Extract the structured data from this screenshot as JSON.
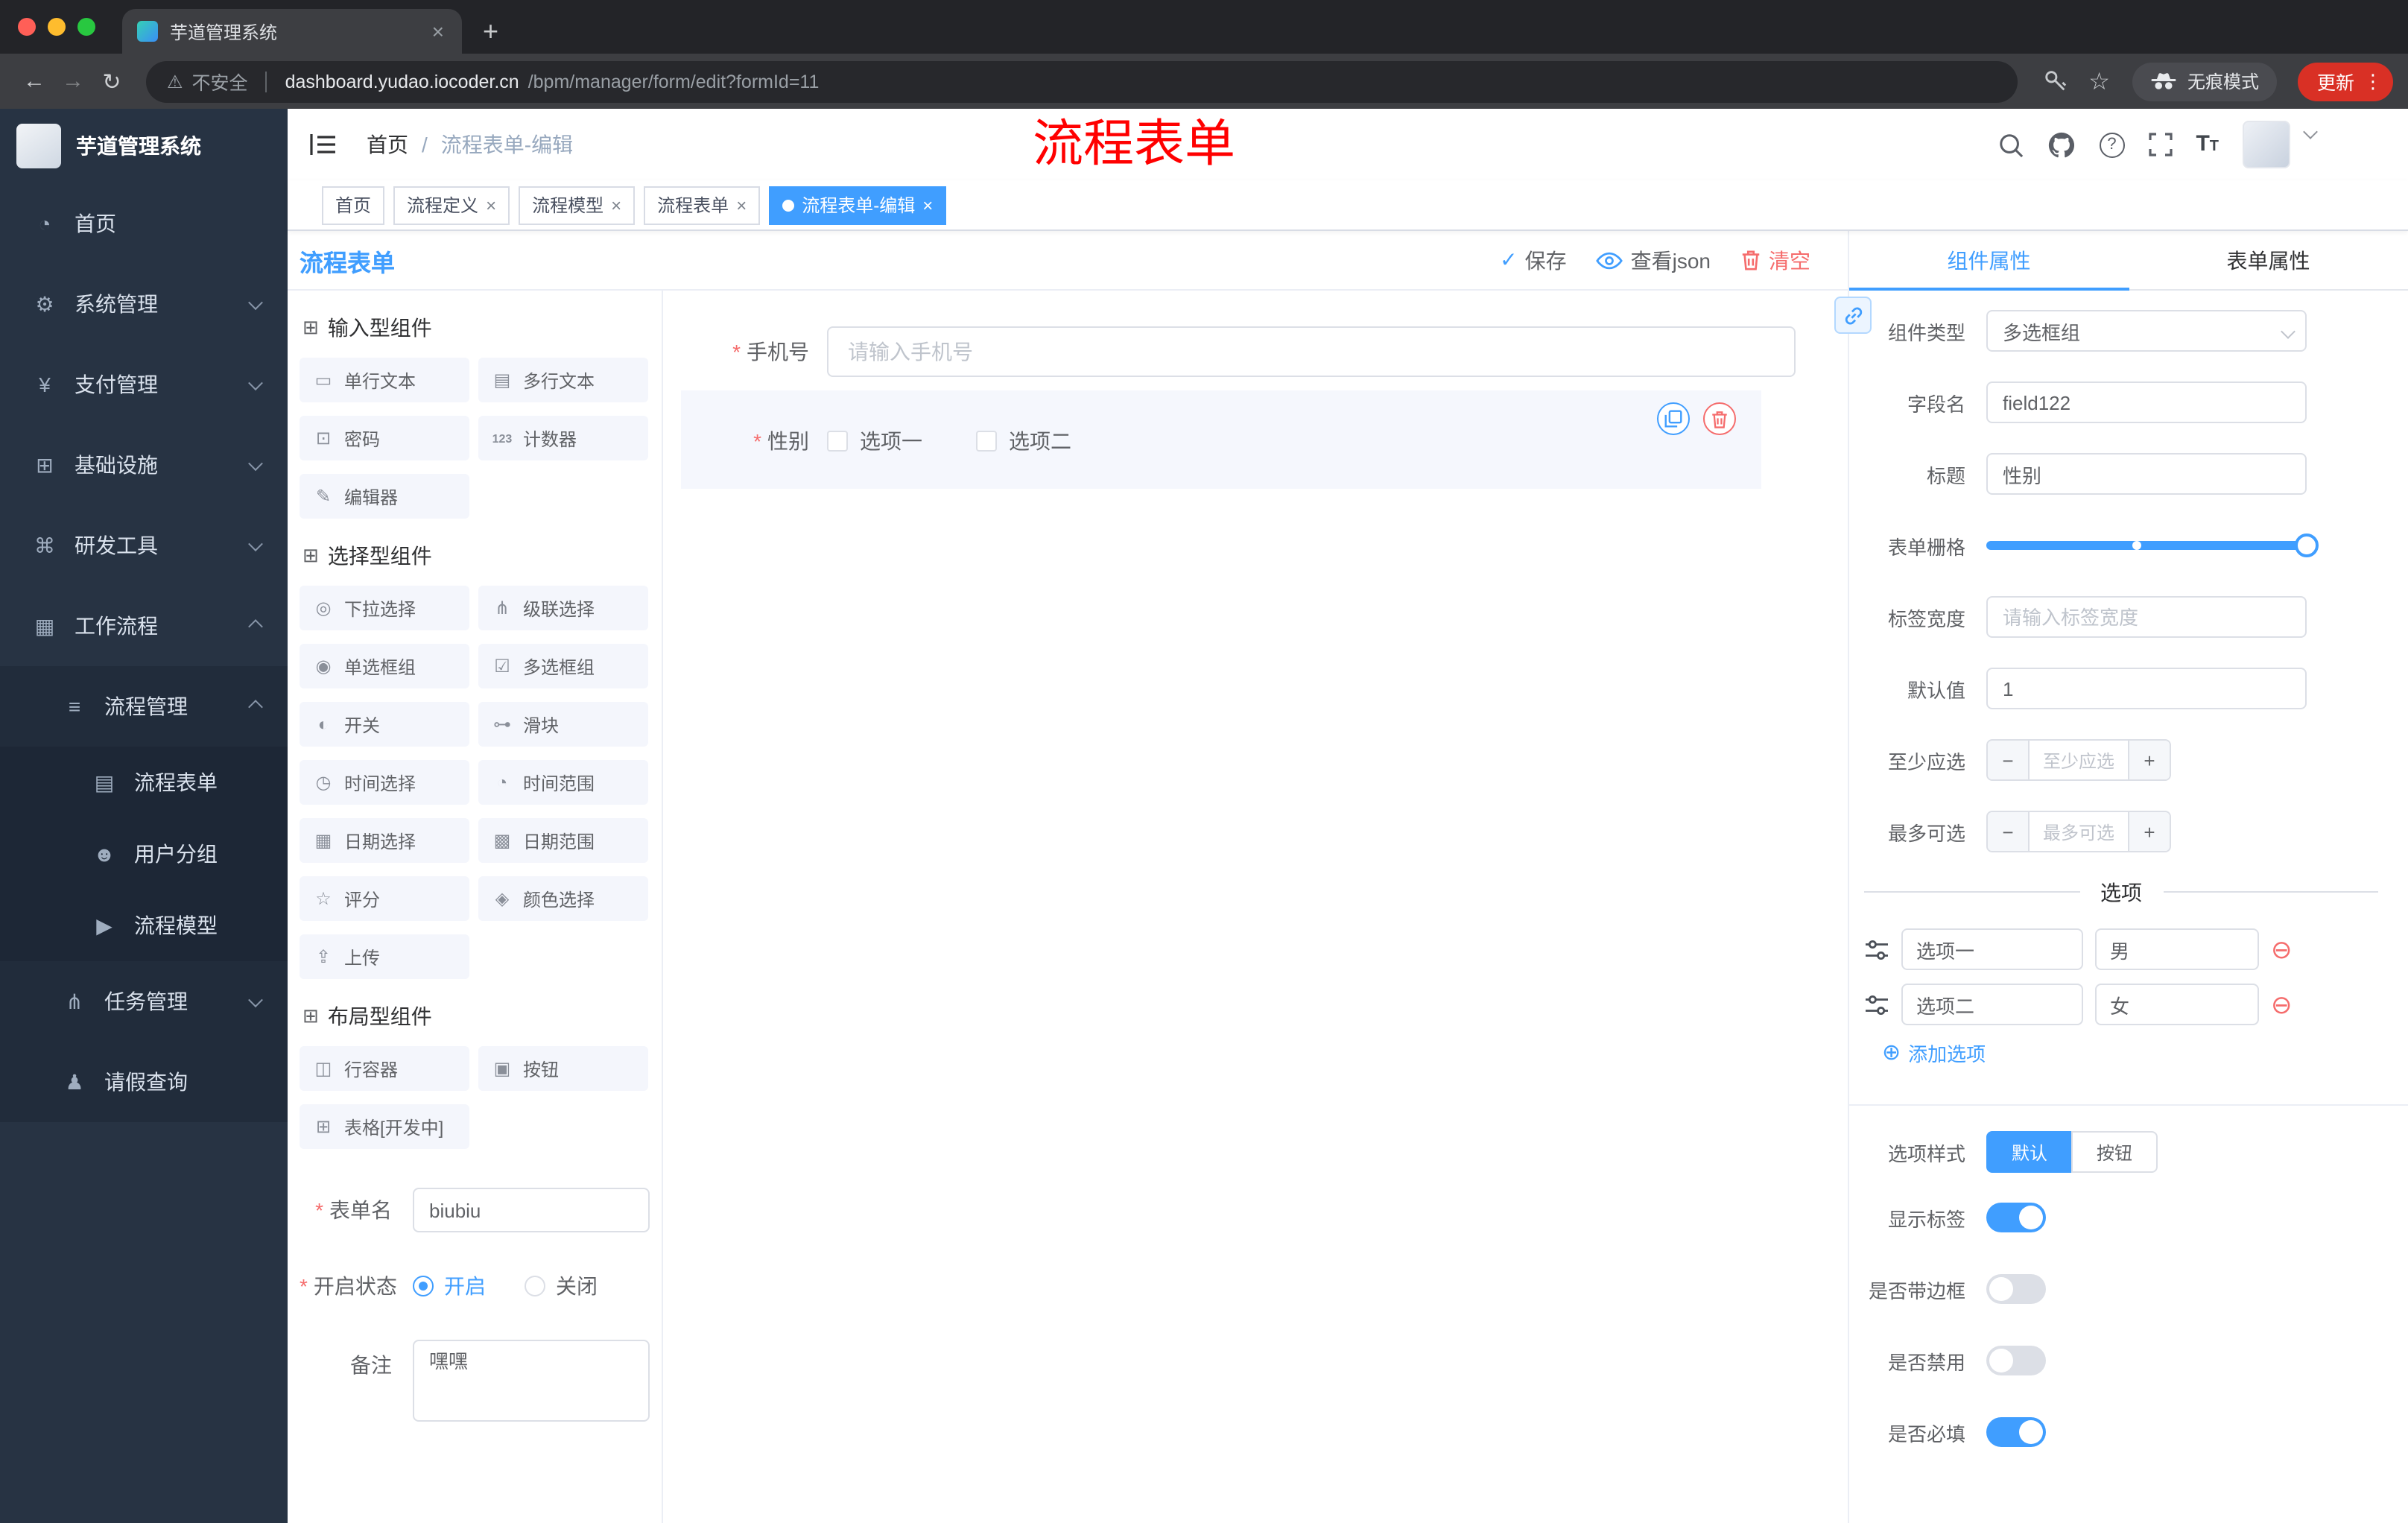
{
  "browser": {
    "tab_title": "芋道管理系统",
    "tab_close": "×",
    "new_tab_icon": "+",
    "back_icon": "←",
    "forward_icon": "→",
    "reload_icon": "↻",
    "warning_icon": "⚠",
    "security_warning": "不安全",
    "url_host": "dashboard.yudao.iocoder.cn",
    "url_path": "/bpm/manager/form/edit?formId=11",
    "bookmark_icon": "☆",
    "incognito_label": "无痕模式",
    "update_label": "更新",
    "menu_dots": "⋮"
  },
  "annotation": {
    "text": "流程表单",
    "color": "#ff0000"
  },
  "sidebar": {
    "logo_title": "芋道管理系统",
    "items": [
      {
        "label": "首页",
        "icon": "◔"
      },
      {
        "label": "系统管理",
        "icon": "⚙",
        "expanded": false
      },
      {
        "label": "支付管理",
        "icon": "¥",
        "expanded": false
      },
      {
        "label": "基础设施",
        "icon": "⊞",
        "expanded": false
      },
      {
        "label": "研发工具",
        "icon": "⌘",
        "expanded": false
      },
      {
        "label": "工作流程",
        "icon": "▦",
        "expanded": true
      },
      {
        "label": "流程管理",
        "icon": "≡",
        "expanded": true
      },
      {
        "label": "流程表单",
        "icon": "▤"
      },
      {
        "label": "用户分组",
        "icon": "☻"
      },
      {
        "label": "流程模型",
        "icon": "▶"
      },
      {
        "label": "任务管理",
        "icon": "⋔",
        "expanded": false
      },
      {
        "label": "请假查询",
        "icon": "♟"
      }
    ]
  },
  "header": {
    "breadcrumb_home": "首页",
    "breadcrumb_separator": "/",
    "breadcrumb_current": "流程表单-编辑",
    "help_glyph": "?",
    "font_icon_big": "T",
    "font_icon_small": "T"
  },
  "tags": [
    {
      "label": "首页"
    },
    {
      "label": "流程定义",
      "close": "×"
    },
    {
      "label": "流程模型",
      "close": "×"
    },
    {
      "label": "流程表单",
      "close": "×"
    },
    {
      "label": "流程表单-编辑",
      "close": "×",
      "active": true
    }
  ],
  "left_panel": {
    "title": "流程表单",
    "actions": {
      "save": "保存",
      "save_icon": "✓",
      "view_json": "查看json",
      "clear": "清空"
    },
    "groups": [
      {
        "title": "输入型组件",
        "items": [
          {
            "label": "单行文本",
            "icon": "▭"
          },
          {
            "label": "多行文本",
            "icon": "▤"
          },
          {
            "label": "密码",
            "icon": "⊡"
          },
          {
            "label": "计数器",
            "icon": "123"
          },
          {
            "label": "编辑器",
            "icon": "✎"
          }
        ]
      },
      {
        "title": "选择型组件",
        "items": [
          {
            "label": "下拉选择",
            "icon": "◎"
          },
          {
            "label": "级联选择",
            "icon": "⋔"
          },
          {
            "label": "单选框组",
            "icon": "◉"
          },
          {
            "label": "多选框组",
            "icon": "☑"
          },
          {
            "label": "开关",
            "icon": "◐"
          },
          {
            "label": "滑块",
            "icon": "⊶"
          },
          {
            "label": "时间选择",
            "icon": "◷"
          },
          {
            "label": "时间范围",
            "icon": "◔"
          },
          {
            "label": "日期选择",
            "icon": "▦"
          },
          {
            "label": "日期范围",
            "icon": "▩"
          },
          {
            "label": "评分",
            "icon": "☆"
          },
          {
            "label": "颜色选择",
            "icon": "◈"
          },
          {
            "label": "上传",
            "icon": "⇪"
          }
        ]
      },
      {
        "title": "布局型组件",
        "items": [
          {
            "label": "行容器",
            "icon": "◫"
          },
          {
            "label": "按钮",
            "icon": "▣"
          },
          {
            "label": "表格[开发中]",
            "icon": "⊞"
          }
        ]
      }
    ],
    "form": {
      "name_label": "表单名",
      "name_value": "biubiu",
      "status_label": "开启状态",
      "status_on": "开启",
      "status_off": "关闭",
      "status_selected": "开启",
      "remark_label": "备注",
      "remark_value": "嘿嘿"
    }
  },
  "canvas": {
    "phone_label": "手机号",
    "phone_placeholder": "请输入手机号",
    "gender_label": "性别",
    "gender_options": [
      "选项一",
      "选项二"
    ]
  },
  "props": {
    "tab_component": "组件属性",
    "tab_form": "表单属性",
    "component_type_label": "组件类型",
    "component_type_value": "多选框组",
    "field_name_label": "字段名",
    "field_name_value": "field122",
    "title_label": "标题",
    "title_value": "性别",
    "grid_label": "表单栅格",
    "label_width_label": "标签宽度",
    "label_width_placeholder": "请输入标签宽度",
    "default_label": "默认值",
    "default_value": "1",
    "min_label": "至少应选",
    "min_placeholder": "至少应选",
    "max_label": "最多可选",
    "max_placeholder": "最多可选",
    "minus_icon": "−",
    "plus_icon": "+",
    "options_title": "选项",
    "options": [
      {
        "name": "选项一",
        "value": "男"
      },
      {
        "name": "选项二",
        "value": "女"
      }
    ],
    "remove_icon": "⊖",
    "add_icon": "⊕",
    "add_option": "添加选项",
    "style_label": "选项样式",
    "style_default": "默认",
    "style_button": "按钮",
    "style_selected": "默认",
    "toggle_show_label": "显示标签",
    "toggle_border": "是否带边框",
    "toggle_disabled": "是否禁用",
    "toggle_required": "是否必填",
    "toggles_state": {
      "show_label": true,
      "border": false,
      "disabled": false,
      "required": true
    }
  },
  "colors": {
    "primary": "#409eff",
    "danger": "#f56c6c",
    "sidebar_bg": "#273343",
    "traffic": {
      "close": "#ff5f57",
      "minimize": "#febc2e",
      "maximize": "#28c840"
    },
    "update_pill": "#d93025"
  }
}
